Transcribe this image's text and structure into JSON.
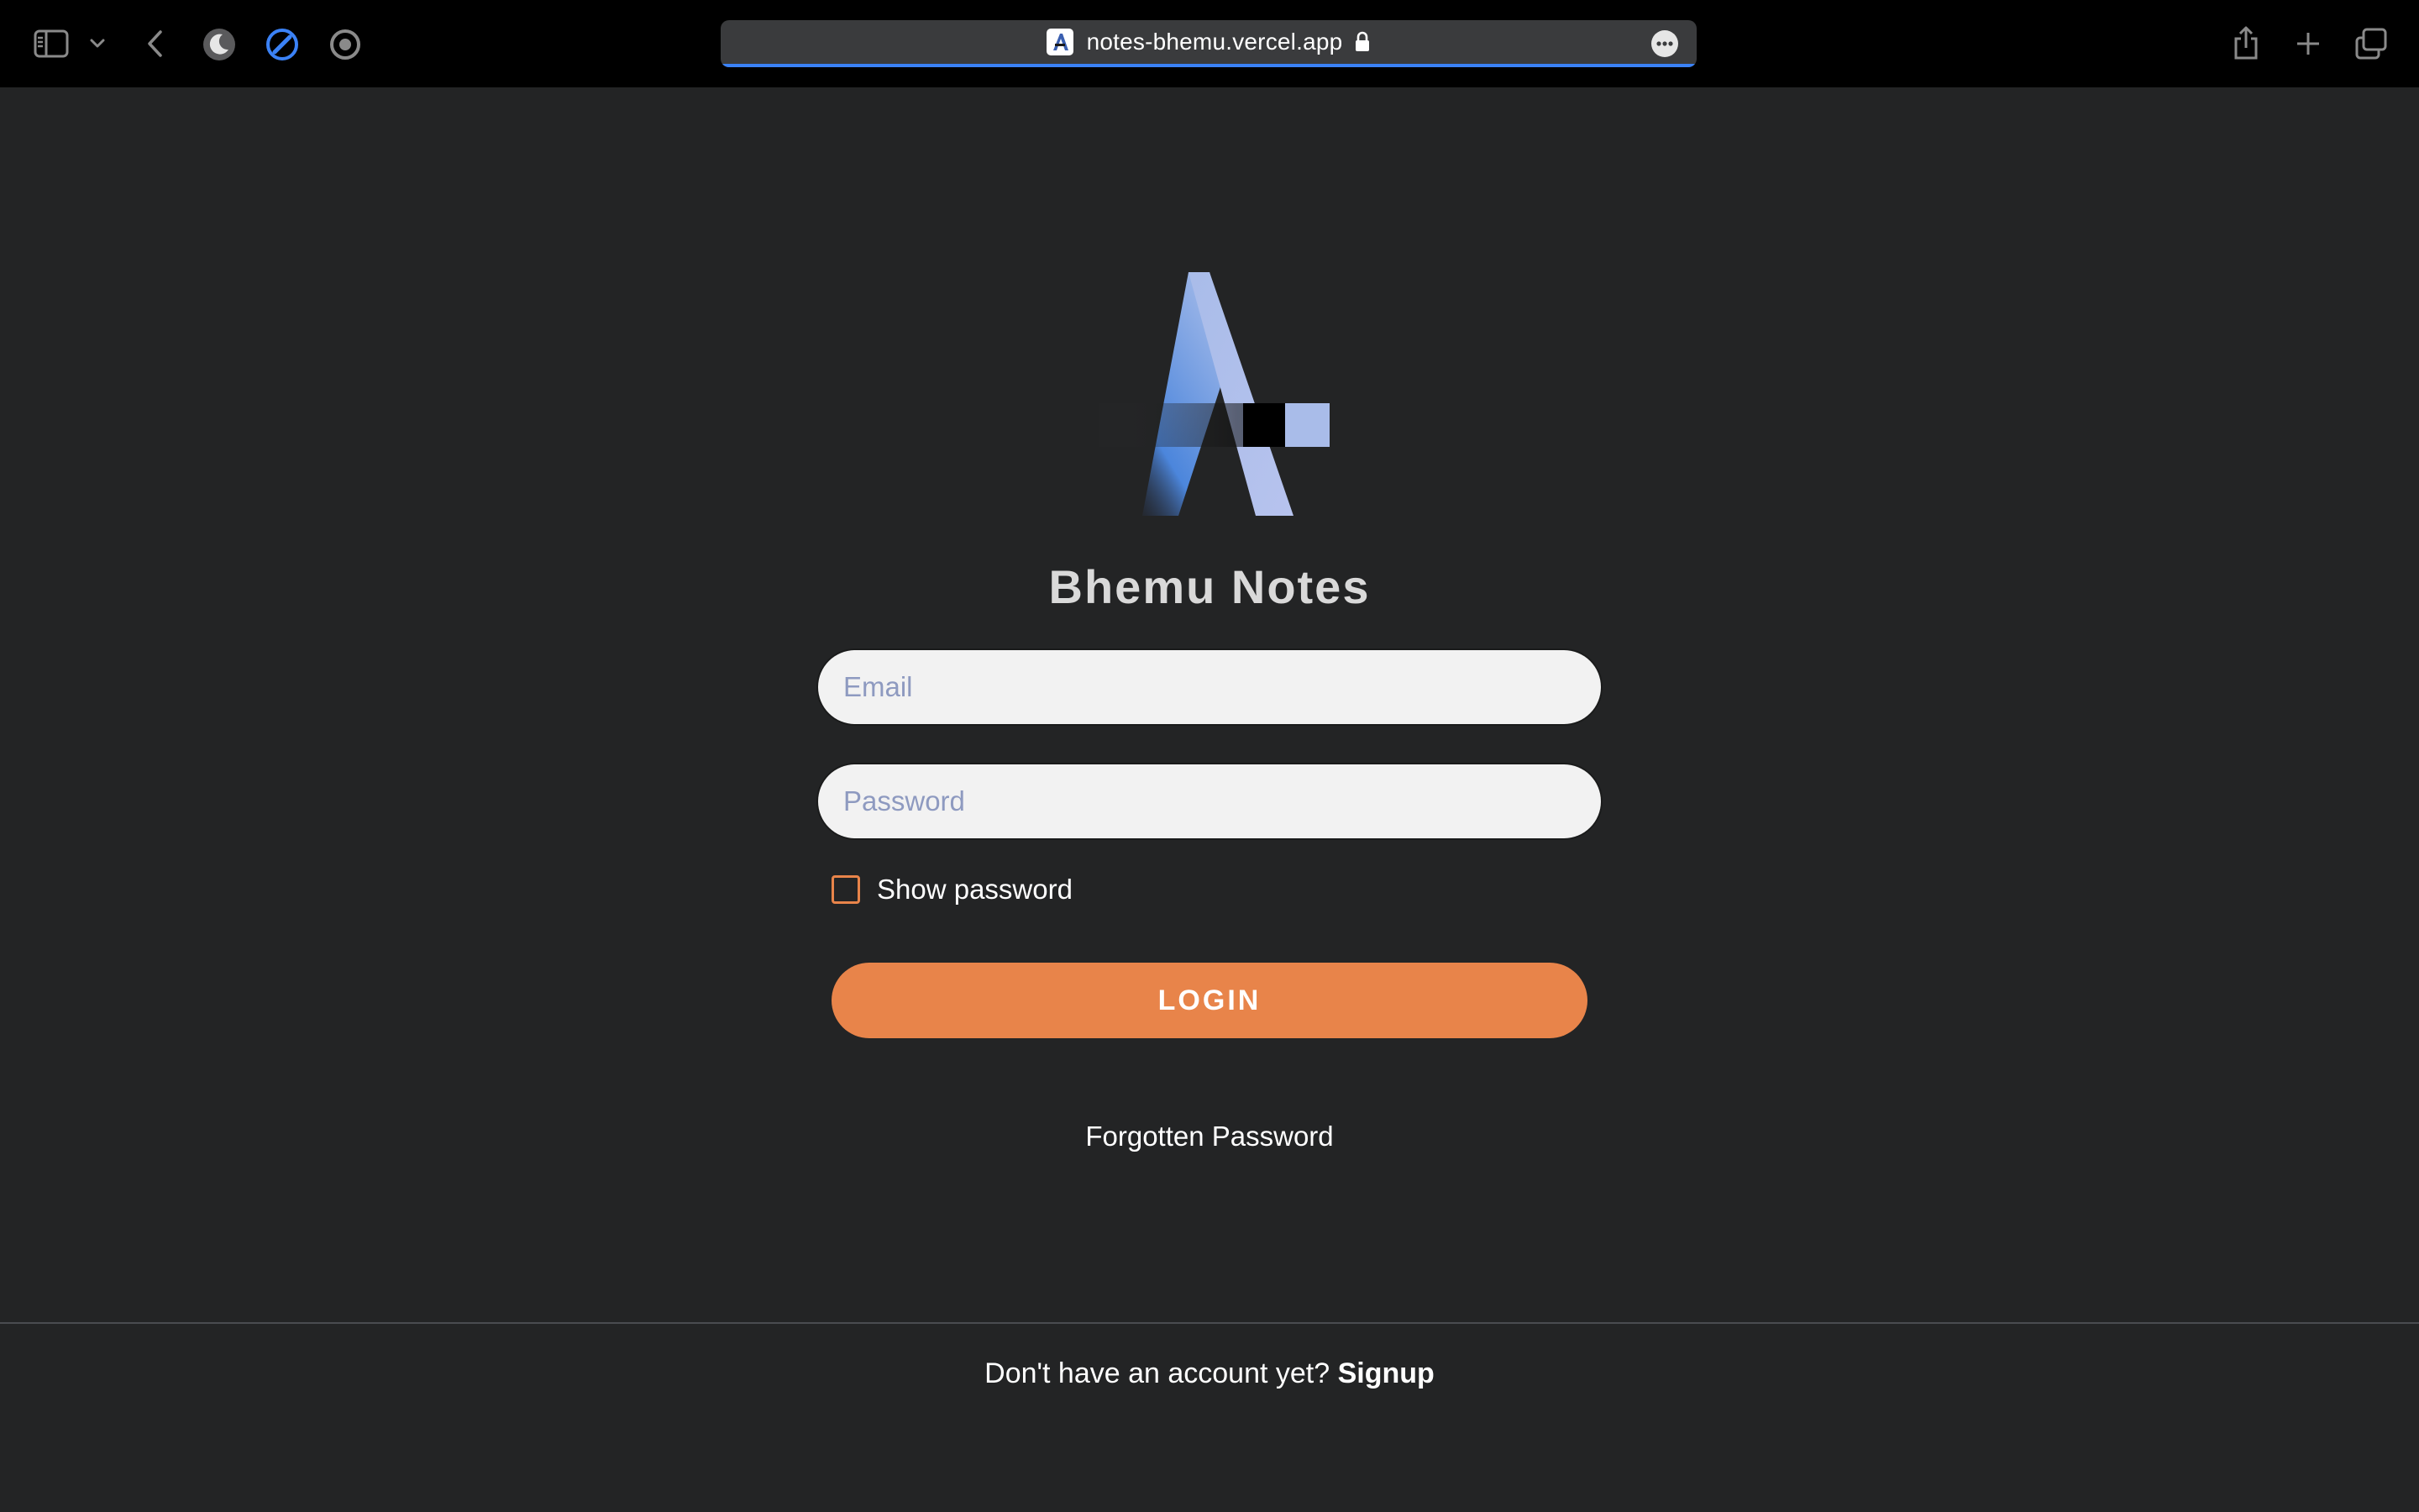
{
  "browser": {
    "url": "notes-bhemu.vercel.app",
    "toolbar_icons": {
      "sidebar": "sidebar-icon",
      "sidebar_menu": "chevron-down-icon",
      "back": "chevron-left-icon",
      "extension_1": "moon-icon",
      "extension_2": "compass-icon",
      "extension_3": "record-icon",
      "share": "share-icon",
      "new_tab": "plus-icon",
      "tabs_overview": "tabs-icon",
      "page_menu": "ellipsis-icon",
      "lock": "lock-icon"
    },
    "accent_color": "#3b82f6"
  },
  "app": {
    "title": "Bhemu Notes",
    "logo": "bhemu-a-logo"
  },
  "form": {
    "email_placeholder": "Email",
    "email_value": "",
    "password_placeholder": "Password",
    "password_value": "",
    "show_password_label": "Show password",
    "show_password_checked": false,
    "login_label": "LOGIN",
    "forgot_label": "Forgotten Password"
  },
  "footer": {
    "prompt": "Don't have an account yet?",
    "signup_label": "Signup"
  },
  "colors": {
    "background": "#232425",
    "accent": "#e8844a",
    "input_background": "#f2f2f2",
    "placeholder": "#8e9ac0"
  }
}
